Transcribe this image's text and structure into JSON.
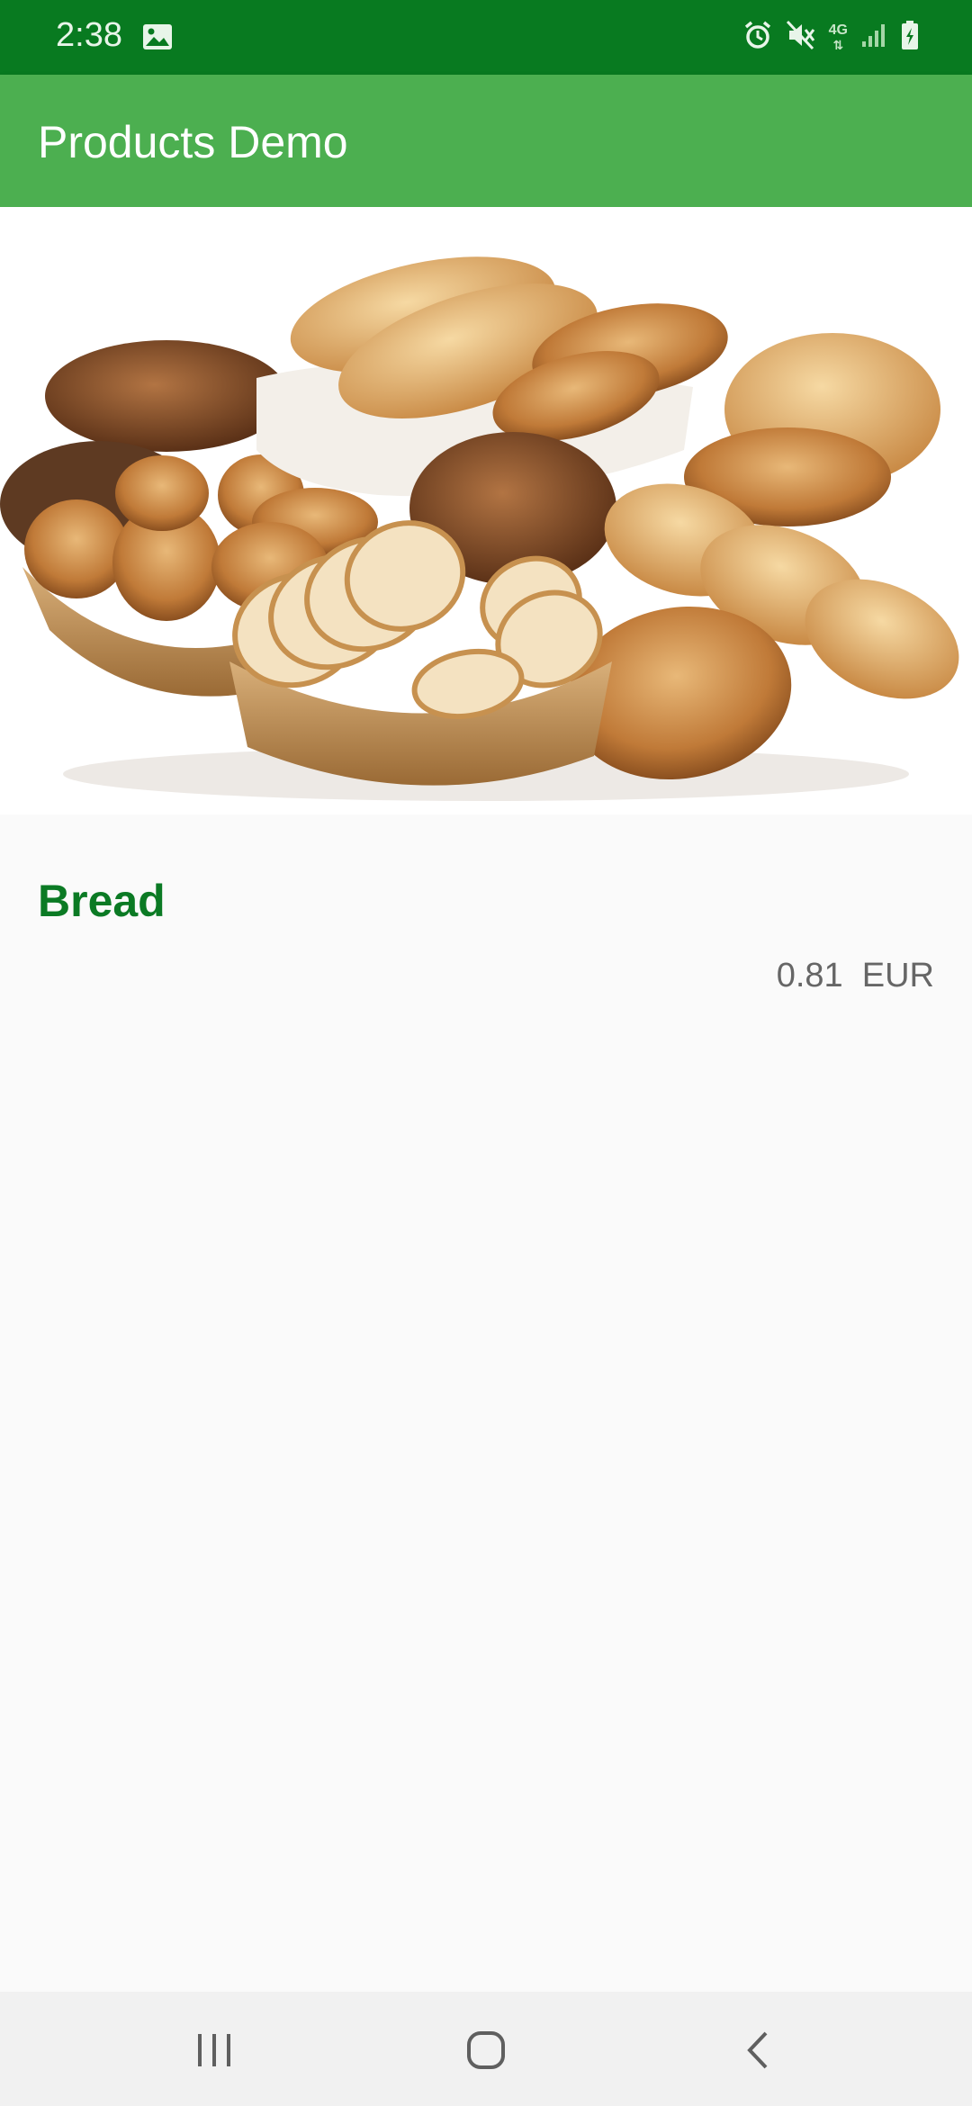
{
  "status_bar": {
    "time": "2:38",
    "icons": [
      "image-icon",
      "alarm-icon",
      "mute-icon",
      "4g-icon",
      "signal-icon",
      "battery-charging-icon"
    ],
    "network_label": "4G"
  },
  "app_bar": {
    "title": "Products Demo"
  },
  "product": {
    "image": "bread-assortment-image",
    "name": "Bread",
    "price": "0.81  EUR"
  },
  "nav_bar": {
    "icons": [
      "recents-icon",
      "home-icon",
      "back-icon"
    ]
  },
  "colors": {
    "status_bar": "#087a20",
    "app_bar": "#4caf50",
    "product_name": "#0b7a24",
    "price": "#666666",
    "background": "#fafafa"
  }
}
